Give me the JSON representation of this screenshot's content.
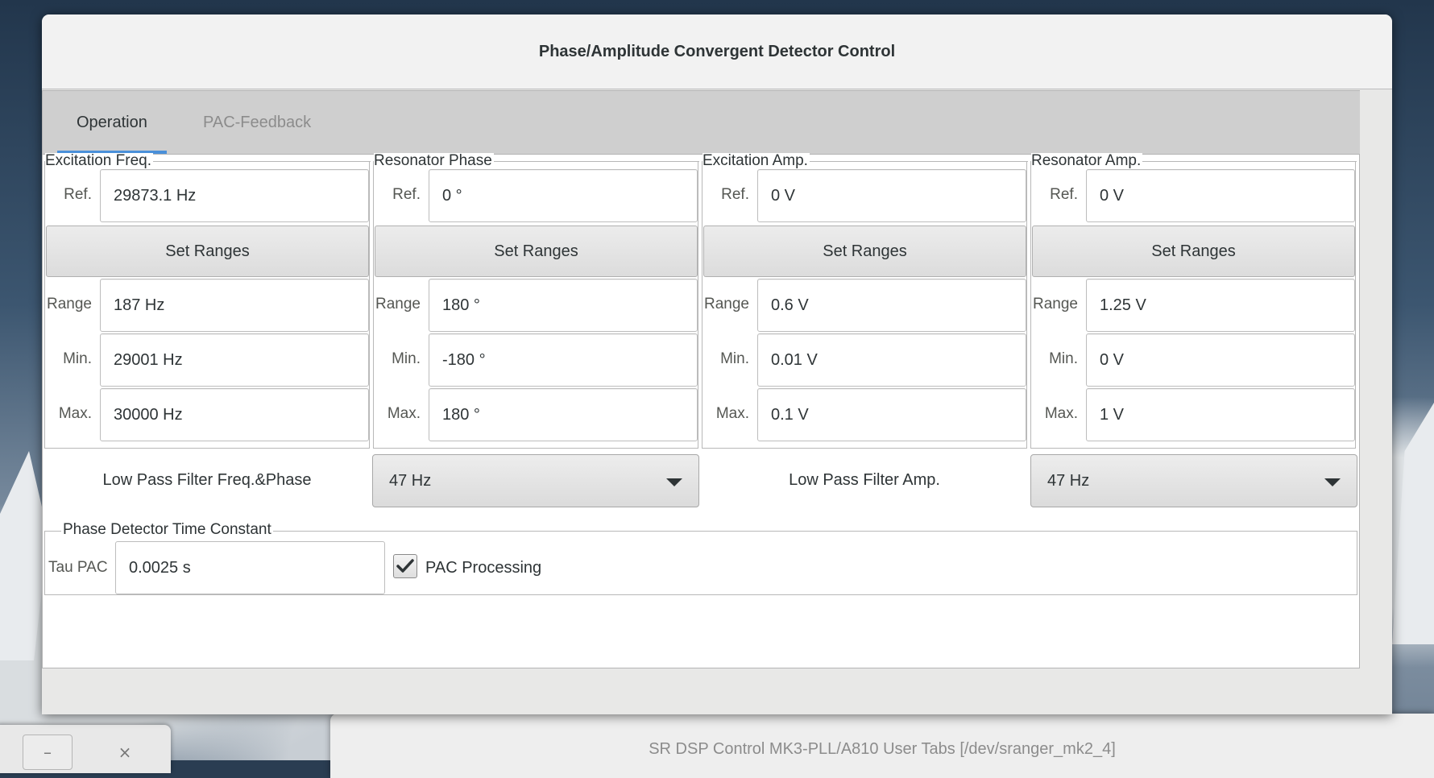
{
  "window": {
    "title": "Phase/Amplitude Convergent Detector Control"
  },
  "tabs": [
    {
      "label": "Operation",
      "active": true
    },
    {
      "label": "PAC-Feedback",
      "active": false
    }
  ],
  "columns": [
    {
      "title": "Excitation Freq.",
      "ref_label": "Ref.",
      "ref": "29873.1 Hz",
      "button": "Set Ranges",
      "range_label": "Range",
      "range": "187 Hz",
      "min_label": "Min.",
      "min": "29001 Hz",
      "max_label": "Max.",
      "max": "30000 Hz"
    },
    {
      "title": "Resonator Phase",
      "ref_label": "Ref.",
      "ref": "0 °",
      "button": "Set Ranges",
      "range_label": "Range",
      "range": "180 °",
      "min_label": "Min.",
      "min": "-180 °",
      "max_label": "Max.",
      "max": "180 °"
    },
    {
      "title": "Excitation Amp.",
      "ref_label": "Ref.",
      "ref": "0 V",
      "button": "Set Ranges",
      "range_label": "Range",
      "range": "0.6 V",
      "min_label": "Min.",
      "min": "0.01 V",
      "max_label": "Max.",
      "max": "0.1 V"
    },
    {
      "title": "Resonator Amp.",
      "ref_label": "Ref.",
      "ref": "0 V",
      "button": "Set Ranges",
      "range_label": "Range",
      "range": "1.25 V",
      "min_label": "Min.",
      "min": "0 V",
      "max_label": "Max.",
      "max": "1 V"
    }
  ],
  "filters": {
    "freq_phase_label": "Low Pass Filter Freq.&Phase",
    "freq_phase_value": "47 Hz",
    "amp_label": "Low Pass Filter Amp.",
    "amp_value": "47 Hz"
  },
  "time_constant": {
    "title": "Phase Detector Time Constant",
    "tau_label": "Tau PAC",
    "tau_value": "0.0025 s",
    "pac_processing_label": "PAC Processing",
    "pac_processing_checked": true
  },
  "background_window": {
    "title": "SR DSP Control MK3-PLL/A810 User Tabs [/dev/sranger_mk2_4]"
  },
  "small_window": {
    "minimize": "–",
    "close": "×"
  },
  "colors": {
    "tab_indicator": "#4a90d9",
    "content_bg": "#ffffff",
    "chrome_bg": "#e8e8e7"
  }
}
